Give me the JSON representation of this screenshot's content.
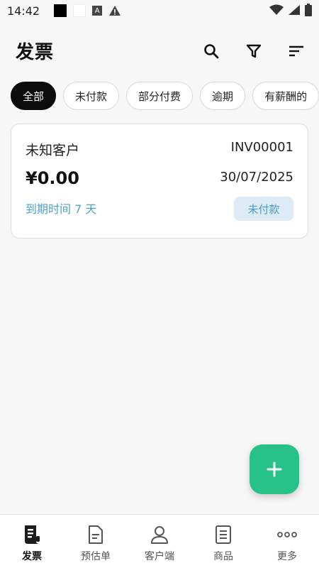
{
  "status_bar": {
    "time": "14:42"
  },
  "header": {
    "title": "发票"
  },
  "filters": [
    {
      "label": "全部",
      "active": true
    },
    {
      "label": "未付款",
      "active": false
    },
    {
      "label": "部分付费",
      "active": false
    },
    {
      "label": "逾期",
      "active": false
    },
    {
      "label": "有薪酬的",
      "active": false
    }
  ],
  "invoice": {
    "client": "未知客户",
    "number": "INV00001",
    "amount": "¥0.00",
    "date": "30/07/2025",
    "due": "到期时间 7 天",
    "status": "未付款"
  },
  "nav": [
    {
      "label": "发票",
      "icon": "invoice-icon",
      "active": true
    },
    {
      "label": "预估单",
      "icon": "estimate-icon",
      "active": false
    },
    {
      "label": "客户端",
      "icon": "person-icon",
      "active": false
    },
    {
      "label": "商品",
      "icon": "list-icon",
      "active": false
    },
    {
      "label": "更多",
      "icon": "more-icon",
      "active": false
    }
  ],
  "colors": {
    "accent": "#27c18a",
    "due_text": "#4aa6c9",
    "badge_bg": "#dcebf5"
  }
}
